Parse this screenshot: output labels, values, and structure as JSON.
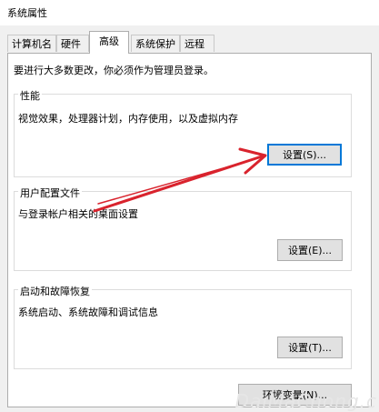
{
  "window": {
    "title": "系统属性"
  },
  "tabs": [
    {
      "label": "计算机名"
    },
    {
      "label": "硬件"
    },
    {
      "label": "高级",
      "active": true
    },
    {
      "label": "系统保护"
    },
    {
      "label": "远程"
    }
  ],
  "admin_note": "要进行大多数更改，你必须作为管理员登录。",
  "groups": {
    "performance": {
      "title": "性能",
      "desc": "视觉效果，处理器计划，内存使用，以及虚拟内存",
      "button": "设置(S)..."
    },
    "user_profiles": {
      "title": "用户配置文件",
      "desc": "与登录帐户相关的桌面设置",
      "button": "设置(E)..."
    },
    "startup": {
      "title": "启动和故障恢复",
      "desc": "系统启动、系统故障和调试信息",
      "button": "设置(T)..."
    }
  },
  "env_button": "环境变量(N)...",
  "watermark": "DaiMaChong.c",
  "colors": {
    "arrow": "#d9232d",
    "focus": "#0078d7"
  }
}
